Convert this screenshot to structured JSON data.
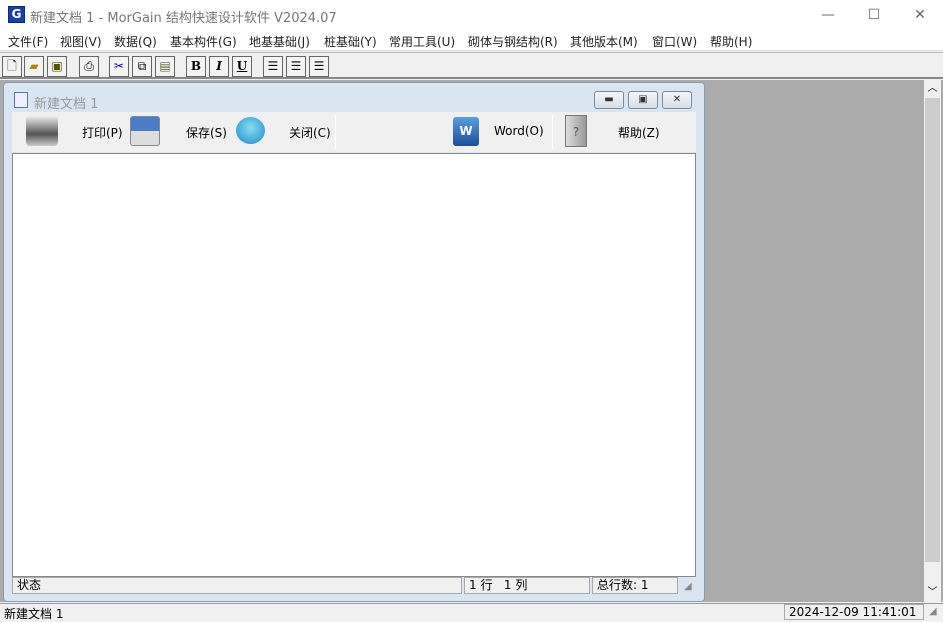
{
  "window": {
    "title": "新建文档 1 - MorGain 结构快速设计软件 V2024.07",
    "icon": "morgain-logo",
    "controls": [
      "minimize-icon",
      "maximize-icon",
      "close-icon"
    ]
  },
  "menu": [
    "文件(F)",
    "视图(V)",
    "数据(Q)",
    "基本构件(G)",
    "地基基础(J)",
    "桩基础(Y)",
    "常用工具(U)",
    "砌体与钢结构(R)",
    "其他版本(M)",
    "窗口(W)",
    "帮助(H)"
  ],
  "toolbar": {
    "bold": "B",
    "italic": "I",
    "underline": "U",
    "icons": [
      "new-icon",
      "open-icon",
      "save-icon",
      "print-icon",
      "cut-icon",
      "copy-icon",
      "paste-icon",
      "bold-icon",
      "italic-icon",
      "underline-icon",
      "align-left-icon",
      "align-center-icon",
      "align-right-icon"
    ]
  },
  "child": {
    "title": "新建文档 1",
    "print": "打印(P)",
    "save": "保存(S)",
    "close": "关闭(C)",
    "word": "Word(O)",
    "help": "帮助(Z)",
    "editor_text": "",
    "status": "状态",
    "position": "1 行   1 列",
    "total": "总行数: 1"
  },
  "statusbar": {
    "doc": "新建文档 1",
    "datetime": "2024-12-09 11:41:01"
  }
}
